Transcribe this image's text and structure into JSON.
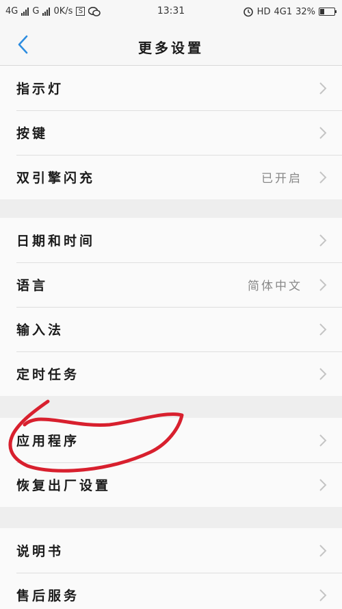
{
  "status_bar": {
    "net1": "4G",
    "net2": "G",
    "speed": "0K/s",
    "s_badge": "S",
    "wechat_icon": "wechat-icon",
    "time": "13:31",
    "hd": "HD",
    "net3": "4G1",
    "battery_percent": "32%",
    "battery_level": 0.32
  },
  "header": {
    "title": "更多设置"
  },
  "groups": [
    [
      {
        "label": "指示灯",
        "value": ""
      },
      {
        "label": "按键",
        "value": ""
      },
      {
        "label": "双引擎闪充",
        "value": "已开启"
      }
    ],
    [
      {
        "label": "日期和时间",
        "value": ""
      },
      {
        "label": "语言",
        "value": "简体中文"
      },
      {
        "label": "输入法",
        "value": ""
      },
      {
        "label": "定时任务",
        "value": ""
      }
    ],
    [
      {
        "label": "应用程序",
        "value": ""
      },
      {
        "label": "恢复出厂设置",
        "value": ""
      }
    ],
    [
      {
        "label": "说明书",
        "value": ""
      },
      {
        "label": "售后服务",
        "value": ""
      }
    ]
  ],
  "colors": {
    "accent": "#2d8de0",
    "annotation": "#d8202e"
  }
}
